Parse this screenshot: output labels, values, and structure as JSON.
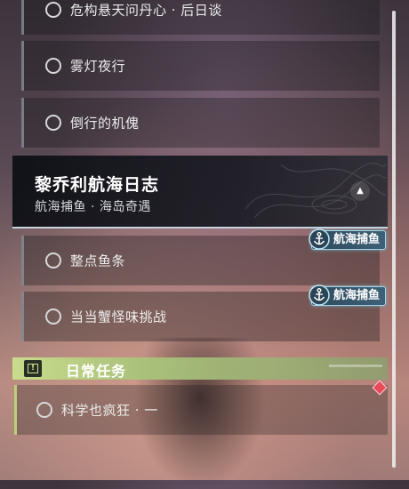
{
  "quests": {
    "items": [
      {
        "label": "危构悬天问丹心 · 后日谈"
      },
      {
        "label": "雾灯夜行"
      },
      {
        "label": "倒行的机傀"
      }
    ]
  },
  "group": {
    "title": "黎乔利航海日志",
    "subtitle": "航海捕鱼 · 海岛奇遇",
    "collapse_icon": "chevron-up-icon",
    "items": [
      {
        "label": "整点鱼条",
        "tag": "航海捕鱼"
      },
      {
        "label": "当当蟹怪味挑战",
        "tag": "航海捕鱼"
      }
    ]
  },
  "daily": {
    "title": "日常任务",
    "badge_icon": "alert-icon",
    "items": [
      {
        "label": "科学也疯狂 · 一"
      }
    ],
    "new_marker_color": "#e64b5a"
  },
  "colors": {
    "daily_accent": "#c9dc8c",
    "tag_border": "#9fd4e8",
    "header_bg": "#0c0e14"
  }
}
